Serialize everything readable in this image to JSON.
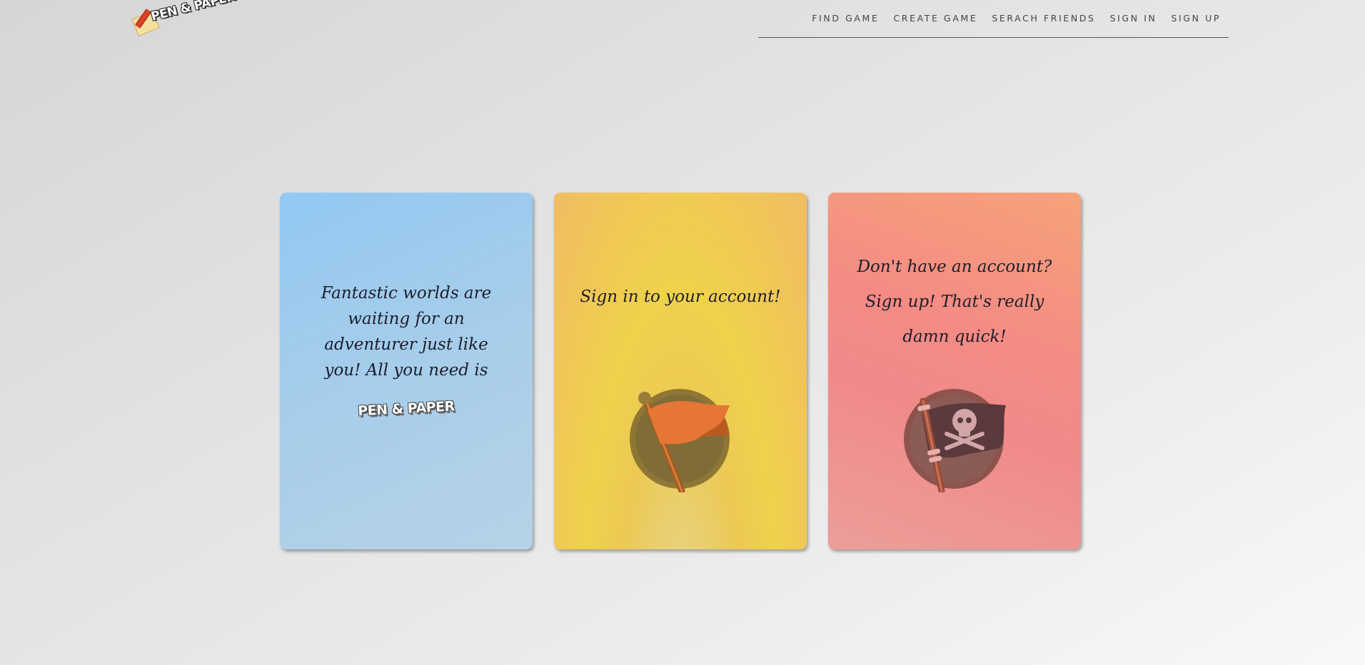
{
  "header": {
    "logo_text": "PEN & PAPER",
    "nav": [
      {
        "label": "FIND GAME"
      },
      {
        "label": "CREATE GAME"
      },
      {
        "label": "SERACH FRIENDS"
      },
      {
        "label": "SIGN IN"
      },
      {
        "label": "SIGN UP"
      }
    ]
  },
  "cards": [
    {
      "text": "Fantastic worlds are waiting for an adventurer just like you! All you need is",
      "logo_text": "PEN & PAPER",
      "color": "#9fcdf0"
    },
    {
      "text": "Sign in to your account!",
      "icon": "flag-icon",
      "color": "#efcb55"
    },
    {
      "text": "Don't have an account? Sign up! That's really damn quick!",
      "icon": "pirate-flag-icon",
      "color": "#f28a85"
    }
  ]
}
